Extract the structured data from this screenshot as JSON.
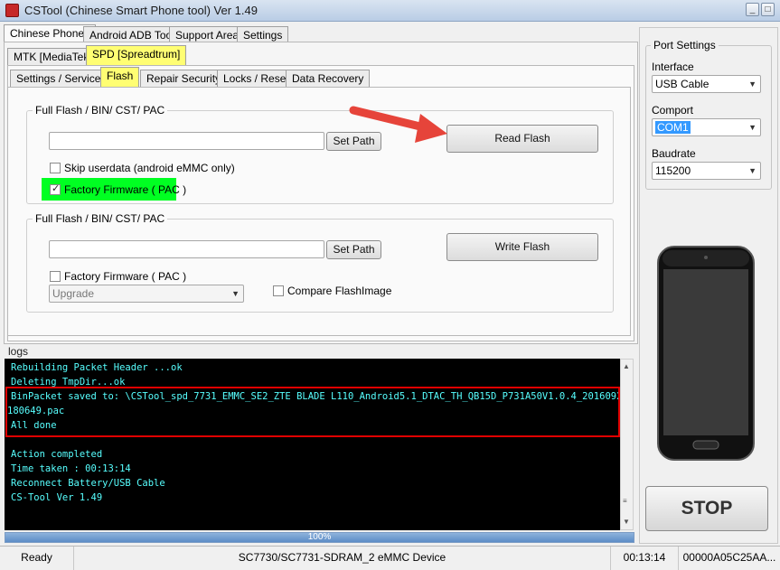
{
  "window": {
    "title": "CSTool (Chinese Smart Phone tool)  Ver 1.49",
    "minimize": "_",
    "maximize": "□"
  },
  "main_tabs": [
    "Chinese Phones",
    "Android ADB Tool",
    "Support Area",
    "Settings"
  ],
  "chip_tabs": [
    "MTK [MediaTek]",
    "SPD [Spreadtrum]"
  ],
  "func_tabs": [
    "Settings / Services",
    "Flash",
    "Repair Security",
    "Locks / Reset",
    "Data Recovery"
  ],
  "read_group": {
    "legend": "Full Flash / BIN/ CST/ PAC",
    "path_value": "",
    "set_path": "Set Path",
    "action_button": "Read Flash",
    "skip_userdata": "Skip userdata (android eMMC only)",
    "factory_firmware": "Factory Firmware ( PAC )"
  },
  "write_group": {
    "legend": "Full Flash / BIN/ CST/ PAC",
    "path_value": "",
    "set_path": "Set Path",
    "action_button": "Write Flash",
    "factory_firmware": "Factory Firmware ( PAC )",
    "mode_select": "Upgrade",
    "compare": "Compare FlashImage"
  },
  "logs": {
    "label": "logs",
    "lines": [
      "Rebuilding Packet Header ...ok",
      "Deleting TmpDir...ok",
      "BinPacket saved to: \\CSTool_spd_7731_EMMC_SE2_ZTE BLADE L110_Android5.1_DTAC_TH_QB15D_P731A50V1.0.4_20160929_",
      "180649.pac",
      "All done",
      "",
      "Action completed",
      "Time taken : 00:13:14",
      "Reconnect Battery/USB Cable",
      "CS-Tool Ver 1.49"
    ]
  },
  "progress": {
    "value": 1.0,
    "label": "100%"
  },
  "port_settings": {
    "legend": "Port Settings",
    "interface_label": "Interface",
    "interface_value": "USB Cable",
    "comport_label": "Comport",
    "comport_value": "COM1",
    "baudrate_label": "Baudrate",
    "baudrate_value": "115200"
  },
  "stop_button": "STOP",
  "status_bar": {
    "state": "Ready",
    "device": "SC7730/SC7731-SDRAM_2 eMMC Device",
    "elapsed": "00:13:14",
    "id": "00000A05C25AA..."
  },
  "colors": {
    "highlight_yellow": "#fffe73",
    "highlight_green": "#00ff22",
    "annotation_red": "#e6443a",
    "log_text": "#57ffff"
  }
}
